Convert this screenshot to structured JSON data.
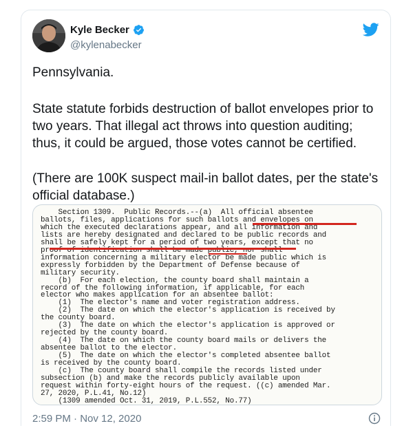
{
  "tweet": {
    "author_name": "Kyle Becker",
    "author_handle": "@kylenabecker",
    "paragraphs": [
      "Pennsylvania.",
      "State statute forbids destruction of ballot envelopes prior to two years. That illegal act throws into question auditing; thus, it could be argued, those votes cannot be certified.",
      "(There are 100K suspect mail-in ballot dates, per the state's official database.)"
    ],
    "timestamp": "2:59 PM · Nov 12, 2020"
  },
  "document_lines": [
    "    Section 1309.  Public Records.--(a)  All official absentee",
    "ballots, files, applications for such ballots and envelopes on",
    "which the executed declarations appear, and all information and",
    "lists are hereby designated and declared to be public records and",
    "shall be safely kept for a period of two years, except that no",
    "proof of identification shall be made public, nor shall",
    "information concerning a military elector be made public which is",
    "expressly forbidden by the Department of Defense because of",
    "military security.",
    "    (b)  For each election, the county board shall maintain a",
    "record of the following information, if applicable, for each",
    "elector who makes application for an absentee ballot:",
    "    (1)  The elector's name and voter registration address.",
    "    (2)  The date on which the elector's application is received by",
    "the county board.",
    "    (3)  The date on which the elector's application is approved or",
    "rejected by the county board.",
    "    (4)  The date on which the county board mails or delivers the",
    "absentee ballot to the elector.",
    "    (5)  The date on which the elector's completed absentee ballot",
    "is received by the county board.",
    "    (c)  The county board shall compile the records listed under",
    "subsection (b) and make the records publicly available upon",
    "request within forty-eight hours of the request. ((c) amended Mar.",
    "27, 2020, P.L.41, No.12)",
    "    (1309 amended Oct. 31, 2019, P.L.552, No.77)"
  ],
  "icons": {
    "avatar": "avatar-photo",
    "verified": "verified-badge-icon",
    "brand": "twitter-bird-icon",
    "info": "info-icon"
  },
  "colors": {
    "twitter_blue": "#1da1f2",
    "underline_red": "#d3261f",
    "secondary_text": "#657786"
  }
}
